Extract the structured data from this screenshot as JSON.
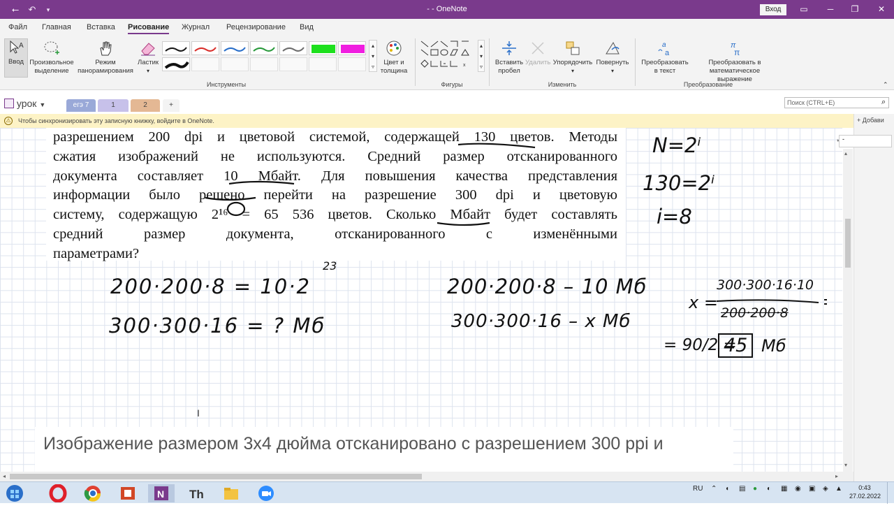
{
  "window": {
    "title": "- - OneNote",
    "login_label": "Вход"
  },
  "tabs": [
    "Файл",
    "Главная",
    "Вставка",
    "Рисование",
    "Журнал",
    "Рецензирование",
    "Вид"
  ],
  "active_tab": "Рисование",
  "ribbon": {
    "vvod": "Ввод",
    "lasso": "Произвольное выделение",
    "lasso_l1": "Произвольное",
    "lasso_l2": "выделение",
    "pan_l1": "Режим",
    "pan_l2": "панорамирования",
    "eraser": "Ластик",
    "color_l1": "Цвет и",
    "color_l2": "толщина",
    "insert_space_l1": "Вставить",
    "insert_space_l2": "пробел",
    "delete": "Удалить",
    "arrange": "Упорядочить",
    "rotate": "Повернуть",
    "ink_text_l1": "Преобразовать",
    "ink_text_l2": "в текст",
    "ink_math_l1": "Преобразовать в",
    "ink_math_l2": "математическое выражение",
    "group_tools": "Инструменты",
    "group_shapes": "Фигуры",
    "group_edit": "Изменить",
    "group_convert": "Преобразование",
    "pen_colors": [
      "#1a1a1a",
      "#d9302c",
      "#2a6fc9",
      "#2a9a3c",
      "#6d6d6d",
      "#1de01d",
      "#f01ee0",
      "#111111"
    ]
  },
  "notebook": {
    "name": "урок",
    "sections": [
      {
        "label": "егэ 7",
        "color": "#9aa9d8"
      },
      {
        "label": "1",
        "color": "#c7c1ea"
      },
      {
        "label": "2",
        "color": "#e4b894"
      }
    ],
    "add_section": "+",
    "search_placeholder": "Поиск (CTRL+E)",
    "add_page": "Добави"
  },
  "notice": "Чтобы синхронизировать эту записную книжку, войдите в OneNote.",
  "problem_lines": [
    "разрешением 200 dpi и цветовой системой, содержащей 130 цветов. Методы",
    "сжатия изображений не используются. Средний размер отсканированного",
    "документа составляет 10 Мбайт. Для повышения качества представления",
    "информации было решено перейти на разрешение 300 dpi и цветовую",
    "систему, содержащую 2¹⁶ = 65 536 цветов. Сколько Мбайт будет составлять",
    "средний размер документа, отсканированного с изменёнными",
    "параметрами?"
  ],
  "handwriting": {
    "n_formula": "N=2ⁱ",
    "n130": "130=2ⁱ",
    "i8": "i=8",
    "calc1": "200·200·8 = 10·2",
    "calc1_exp": "23",
    "calc2": "300·300·16 = ? Мб",
    "prop1": "200·200·8 – 10 Мб",
    "prop2": "300·300·16  –  x Мб",
    "x_eq": "x =",
    "x_num": "300·300·16·10",
    "x_den": "200·200·8",
    "result_eq": "= 90/2 =",
    "result_val": "45",
    "result_unit": "Мб"
  },
  "bottom_text": "Изображение размером 3х4 дюйма отсканировано с разрешением 300 ppi и",
  "taskbar": {
    "lang": "RU",
    "time": "0:43",
    "date": "27.02.2022"
  }
}
